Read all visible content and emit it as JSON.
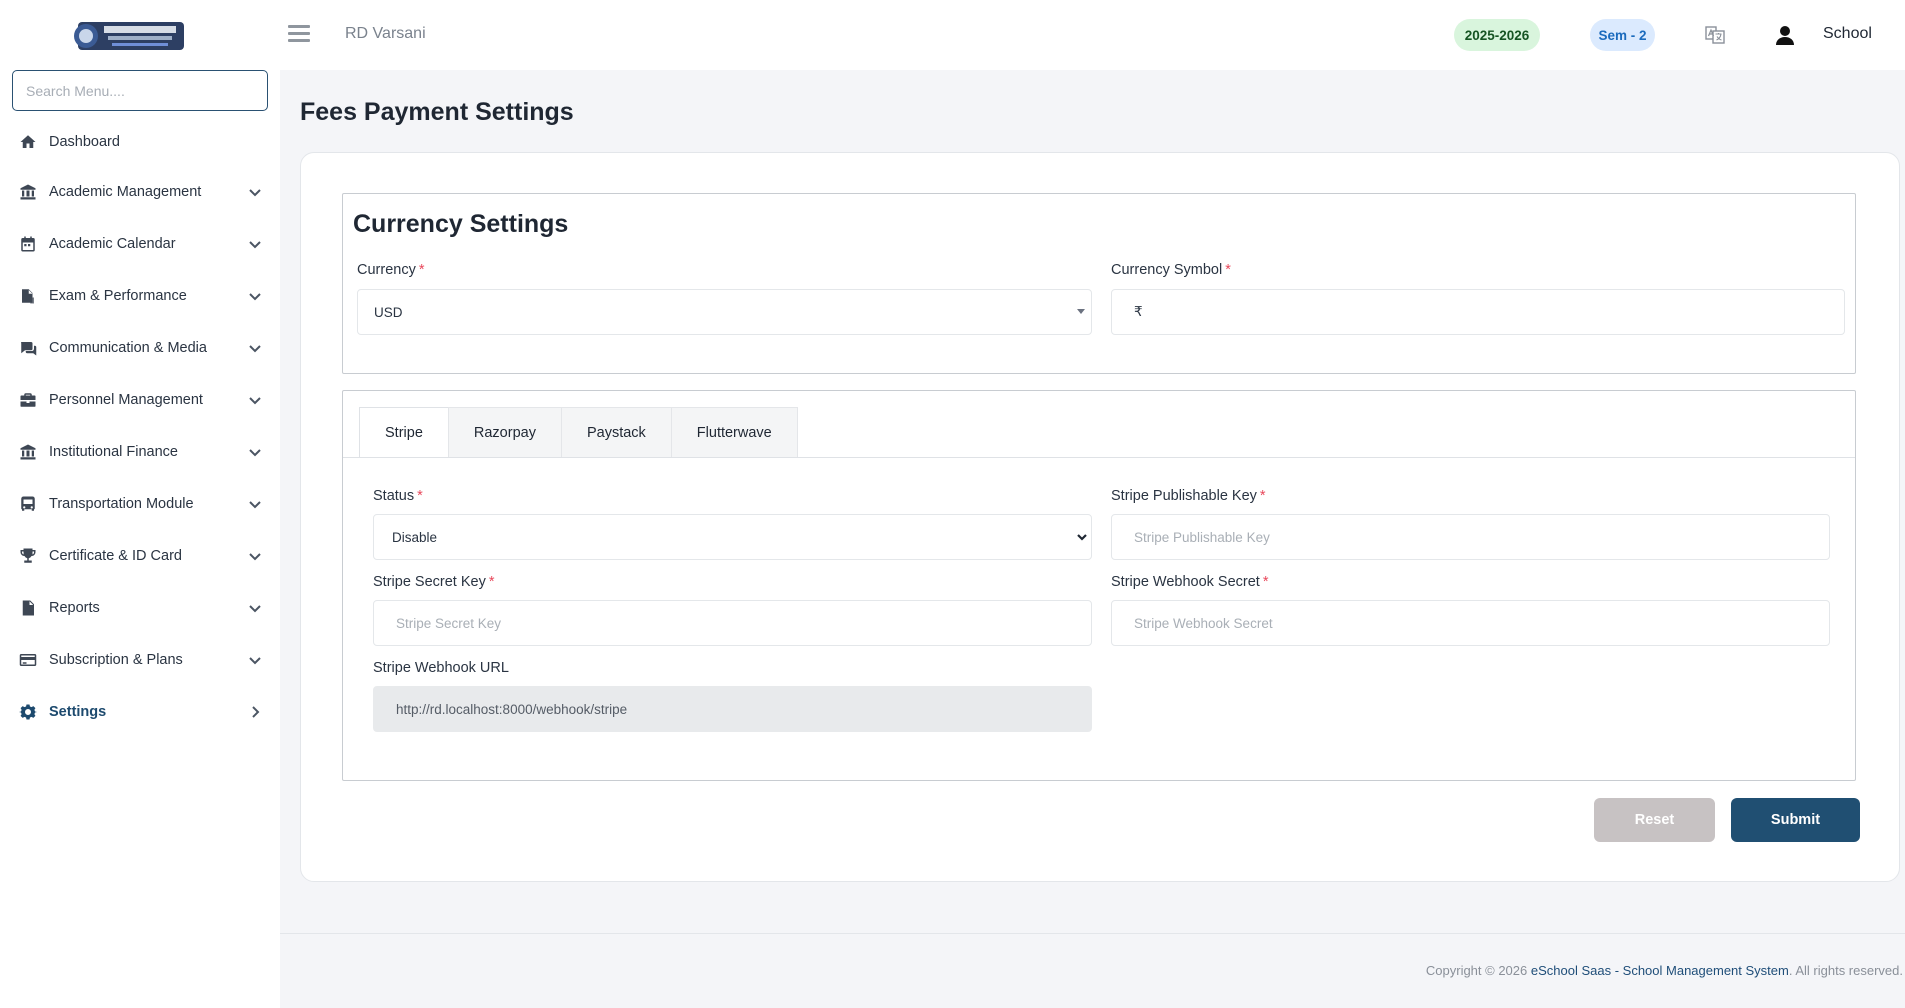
{
  "topbar": {
    "school_name": "RD Varsani",
    "session": "2025-2026",
    "semester": "Sem - 2",
    "user_label": "School"
  },
  "sidebar": {
    "search_placeholder": "Search Menu....",
    "items": [
      {
        "label": "Dashboard",
        "icon": "home-icon"
      },
      {
        "label": "Academic Management",
        "icon": "institution-icon"
      },
      {
        "label": "Academic Calendar",
        "icon": "calendar-icon"
      },
      {
        "label": "Exam & Performance",
        "icon": "exam-icon"
      },
      {
        "label": "Communication & Media",
        "icon": "chat-icon"
      },
      {
        "label": "Personnel Management",
        "icon": "briefcase-icon"
      },
      {
        "label": "Institutional Finance",
        "icon": "institution-icon"
      },
      {
        "label": "Transportation Module",
        "icon": "bus-icon"
      },
      {
        "label": "Certificate & ID Card",
        "icon": "trophy-icon"
      },
      {
        "label": "Reports",
        "icon": "report-icon"
      },
      {
        "label": "Subscription & Plans",
        "icon": "credit-card-icon"
      },
      {
        "label": "Settings",
        "icon": "gear-icon"
      }
    ]
  },
  "page": {
    "title": "Fees Payment Settings"
  },
  "currency": {
    "title": "Currency Settings",
    "currency_label": "Currency",
    "currency_value": "USD",
    "symbol_label": "Currency Symbol",
    "symbol_value": "₹"
  },
  "gateways": {
    "tabs": [
      "Stripe",
      "Razorpay",
      "Paystack",
      "Flutterwave"
    ],
    "active_tab": "Stripe",
    "stripe": {
      "status_label": "Status",
      "status_value": "Disable",
      "publishable_label": "Stripe Publishable Key",
      "publishable_placeholder": "Stripe Publishable Key",
      "secret_label": "Stripe Secret Key",
      "secret_placeholder": "Stripe Secret Key",
      "webhook_secret_label": "Stripe Webhook Secret",
      "webhook_secret_placeholder": "Stripe Webhook Secret",
      "webhook_url_label": "Stripe Webhook URL",
      "webhook_url_value": "http://rd.localhost:8000/webhook/stripe"
    }
  },
  "actions": {
    "reset": "Reset",
    "submit": "Submit"
  },
  "footer": {
    "prefix": "Copyright © 2026",
    "link": "eSchool Saas - School Management System",
    "suffix": ". All rights reserved."
  },
  "colors": {
    "accent": "#204f72",
    "session_badge_bg": "#d9f5dd",
    "semester_badge_bg": "#dbeafe",
    "required": "#e8485b"
  }
}
